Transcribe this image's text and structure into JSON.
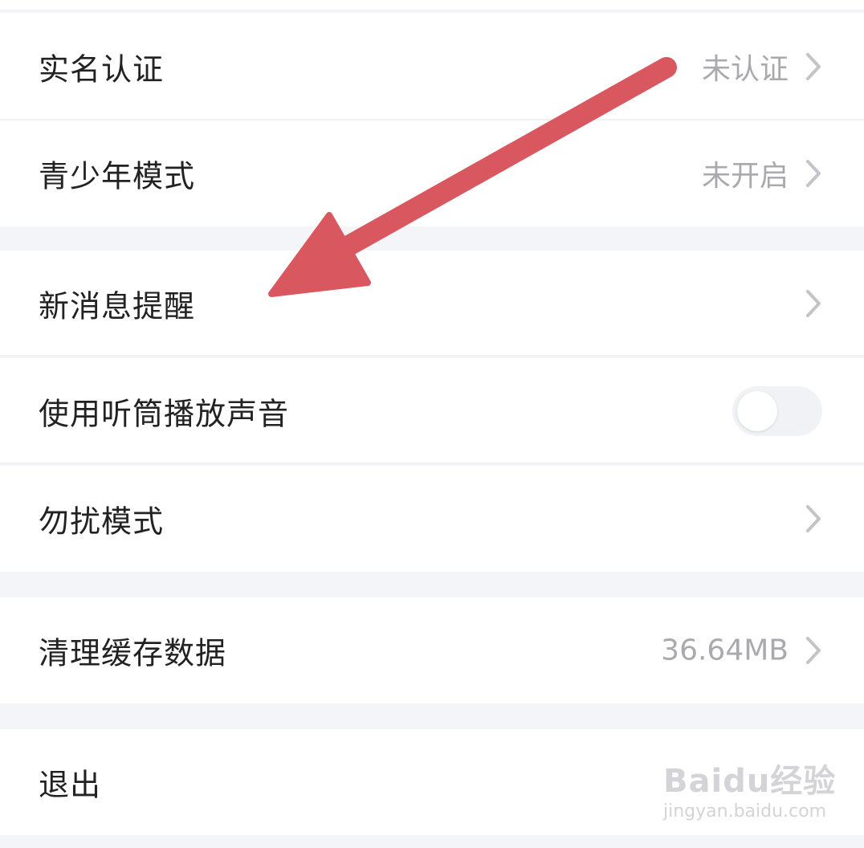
{
  "settings": {
    "rows": [
      {
        "label": "实名认证",
        "value": "未认证"
      },
      {
        "label": "青少年模式",
        "value": "未开启"
      },
      {
        "label": "新消息提醒",
        "value": ""
      },
      {
        "label": "使用听筒播放声音",
        "toggle_on": false
      },
      {
        "label": "勿扰模式",
        "value": ""
      },
      {
        "label": "清理缓存数据",
        "value": "36.64MB"
      },
      {
        "label": "退出"
      }
    ]
  },
  "annotation": {
    "arrow_color": "#d9575e",
    "arrow_icon": "red-arrow-icon"
  },
  "watermark": {
    "brand": "Baidu经验",
    "url": "jingyan.baidu.com"
  },
  "colors": {
    "background": "#f4f5f9",
    "row": "#ffffff",
    "text": "#222222",
    "secondary": "#a9a9ae"
  }
}
